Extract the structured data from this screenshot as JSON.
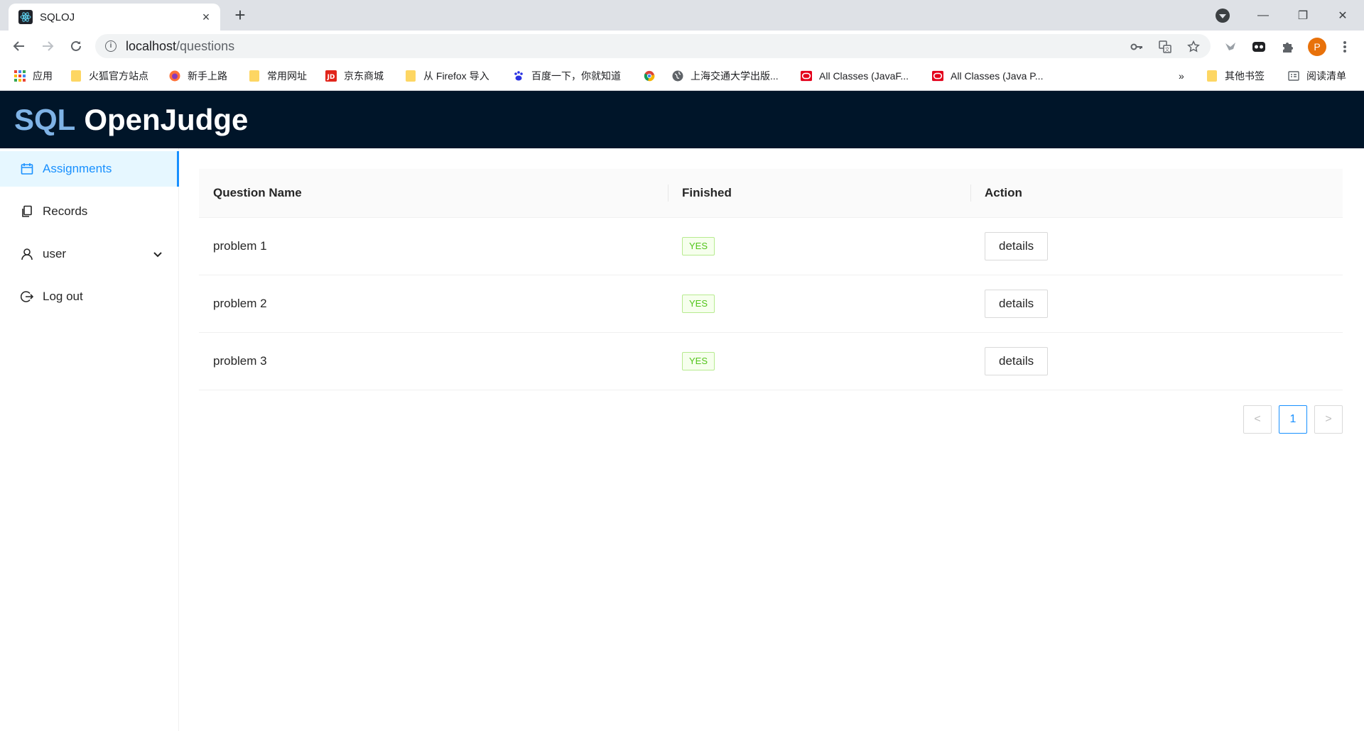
{
  "browser": {
    "tab": {
      "title": "SQLOJ",
      "close_glyph": "×",
      "favicon": "react-icon"
    },
    "new_tab_glyph": "+",
    "window_controls": {
      "minimize": "—",
      "restore": "❐",
      "close": "✕"
    },
    "url": {
      "host": "localhost",
      "path": "/questions"
    },
    "profile_initial": "P",
    "bookmarks": [
      {
        "label": "应用",
        "icon": "apps-grid-icon"
      },
      {
        "label": "火狐官方站点",
        "icon": "folder-icon"
      },
      {
        "label": "新手上路",
        "icon": "firefox-icon"
      },
      {
        "label": "常用网址",
        "icon": "folder-icon"
      },
      {
        "label": "京东商城",
        "icon": "jd-icon"
      },
      {
        "label": "从 Firefox 导入",
        "icon": "folder-icon"
      },
      {
        "label": "百度一下，你就知道",
        "icon": "baidu-icon"
      },
      {
        "label": "",
        "icon": "chrome-icon"
      },
      {
        "label": "上海交通大学出版...",
        "icon": "globe-icon"
      },
      {
        "label": "All Classes (JavaF...",
        "icon": "oracle-icon"
      },
      {
        "label": "All Classes (Java P...",
        "icon": "oracle-icon"
      }
    ],
    "bookmarks_overflow": "»",
    "other_bookmarks": "其他书签",
    "reading_list": "阅读清单"
  },
  "header": {
    "logo_sql": "SQL",
    "logo_rest": "OpenJudge"
  },
  "sidebar": {
    "items": [
      {
        "label": "Assignments",
        "icon": "calendar-icon",
        "active": true
      },
      {
        "label": "Records",
        "icon": "copy-icon",
        "active": false
      },
      {
        "label": "user",
        "icon": "user-icon",
        "active": false
      },
      {
        "label": "Log out",
        "icon": "logout-icon",
        "active": false
      }
    ]
  },
  "table": {
    "columns": [
      "Question Name",
      "Finished",
      "Action"
    ],
    "rows": [
      {
        "name": "problem 1",
        "finished": "YES",
        "action": "details"
      },
      {
        "name": "problem 2",
        "finished": "YES",
        "action": "details"
      },
      {
        "name": "problem 3",
        "finished": "YES",
        "action": "details"
      }
    ]
  },
  "pagination": {
    "prev": "<",
    "current": "1",
    "next": ">"
  },
  "colors": {
    "header_bg": "#001529",
    "accent": "#1890ff",
    "success": "#52c41a"
  }
}
